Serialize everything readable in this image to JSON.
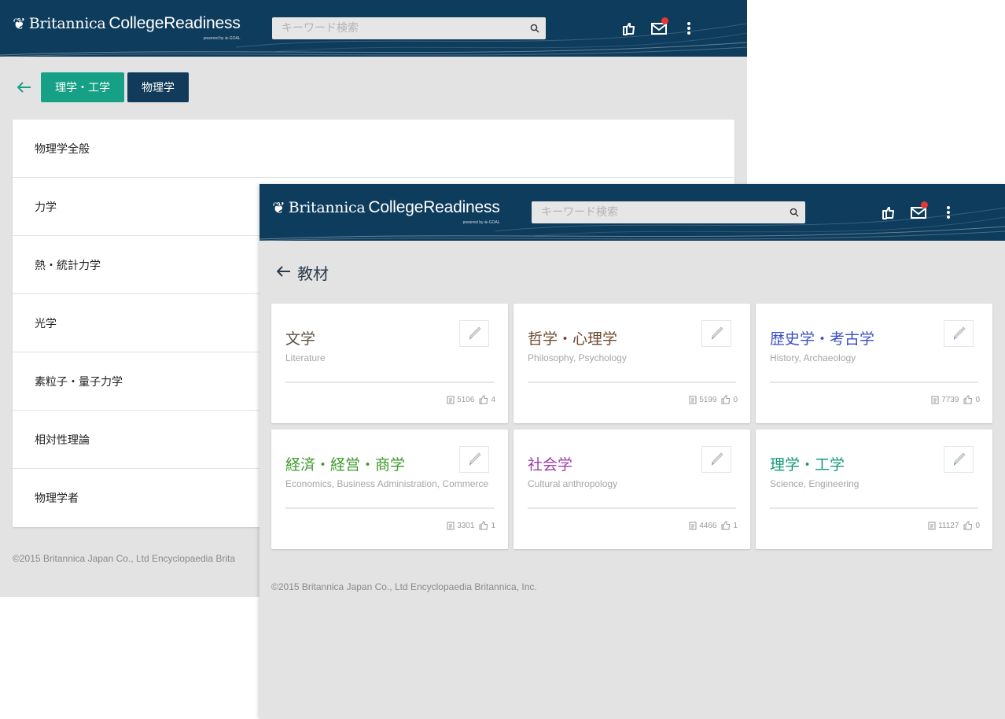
{
  "back_window": {
    "brand": {
      "name1": "Britannica",
      "name2": "CollegeReadiness",
      "powered": "powered by ⊕-GOAL"
    },
    "search": {
      "placeholder": "キーワード検索"
    },
    "breadcrumb": {
      "field": "理学・工学",
      "subject": "物理学"
    },
    "topics": [
      "物理学全般",
      "力学",
      "熱・統計力学",
      "光学",
      "素粒子・量子力学",
      "相対性理論",
      "物理学者"
    ],
    "footer": "©2015 Britannica Japan Co., Ltd Encyclopaedia Brita"
  },
  "front_window": {
    "brand": {
      "name1": "Britannica",
      "name2": "CollegeReadiness",
      "powered": "powered by ⊕-GOAL"
    },
    "search": {
      "placeholder": "キーワード検索"
    },
    "page_title": "教材",
    "cards": [
      {
        "title": "文学",
        "subtitle": "Literature",
        "docs": "5106",
        "shares": "4",
        "color": "#5b5047",
        "pencil": "#8a8a8a"
      },
      {
        "title": "哲学・心理学",
        "subtitle": "Philosophy, Psychology",
        "docs": "5199",
        "shares": "0",
        "color": "#6d4a2e",
        "pencil": "#8a8a8a"
      },
      {
        "title": "歴史学・考古学",
        "subtitle": "History, Archaeology",
        "docs": "7739",
        "shares": "0",
        "color": "#3a4fc6",
        "pencil": "#4a63d0"
      },
      {
        "title": "経済・経営・商学",
        "subtitle": "Economics, Business Administration, Commerce",
        "docs": "3301",
        "shares": "1",
        "color": "#3f9a2e",
        "pencil": "#4fb04a"
      },
      {
        "title": "社会学",
        "subtitle": "Cultural anthropology",
        "docs": "4466",
        "shares": "1",
        "color": "#9b3fa6",
        "pencil": "#b055c0"
      },
      {
        "title": "理学・工学",
        "subtitle": "Science, Engineering",
        "docs": "11127",
        "shares": "0",
        "color": "#16997d",
        "pencil": "#1aa37e"
      }
    ],
    "footer": "©2015 Britannica Japan Co., Ltd Encyclopaedia Britannica, Inc."
  },
  "colors": {
    "appbar": "#0e3c5c",
    "page_bg": "#e3e3e3",
    "crumb_green": "#16a085",
    "crumb_navy": "#123b5b",
    "notification": "#e53935"
  },
  "icons": [
    "thistle-logo-icon",
    "search-icon",
    "share-hand-icon",
    "mail-icon",
    "more-vert-icon",
    "back-arrow-icon",
    "pencil-icon",
    "document-icon",
    "share-icon"
  ]
}
